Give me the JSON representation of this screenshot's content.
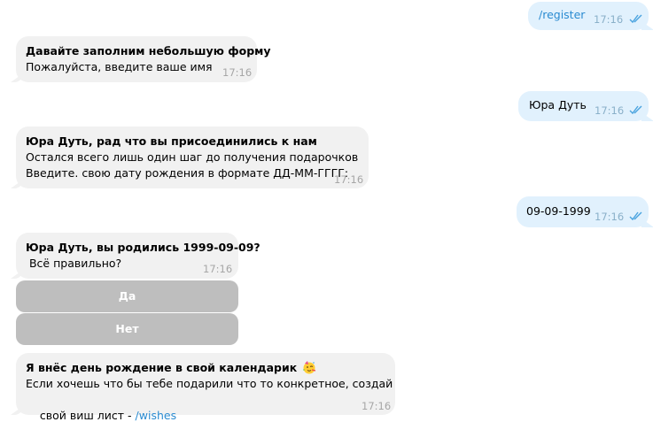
{
  "messages": [
    {
      "dir": "out",
      "text": "/register",
      "time": "17:16"
    },
    {
      "dir": "in",
      "title": "Давайте заполним небольшую форму",
      "lines": [
        "Пожалуйста, введите ваше имя"
      ],
      "time": "17:16"
    },
    {
      "dir": "out",
      "text": "Юра Дуть",
      "time": "17:16"
    },
    {
      "dir": "in",
      "title": "Юра Дуть, рад что вы присоединились к нам",
      "lines": [
        "Остался всего лишь один шаг до получения подарочков",
        "Введите. свою дату рождения в формате ДД-ММ-ГГГГ:"
      ],
      "time": "17:16"
    },
    {
      "dir": "out",
      "text": "09-09-1999",
      "time": "17:16"
    },
    {
      "dir": "in",
      "title": "Юра Дуть, вы родились 1999-09-09?",
      "lines": [
        " Всё правильно?"
      ],
      "time": "17:16"
    },
    {
      "dir": "in",
      "title": "Я внёс день рождение в свой календарик",
      "lines": [
        "Если хочешь что бы тебе подарили что то конкретное, создай",
        "свой виш лист - "
      ],
      "link": "/wishes",
      "time": "17:16"
    }
  ],
  "keyboard": [
    "Да",
    "Нет"
  ],
  "emoji_icon": "party-face-emoji",
  "colors": {
    "incoming": "#f1f1f1",
    "outgoing": "#e1f1fd",
    "link": "#2a8bd1",
    "button": "#bebebe",
    "ticks": "#4aa3df"
  }
}
